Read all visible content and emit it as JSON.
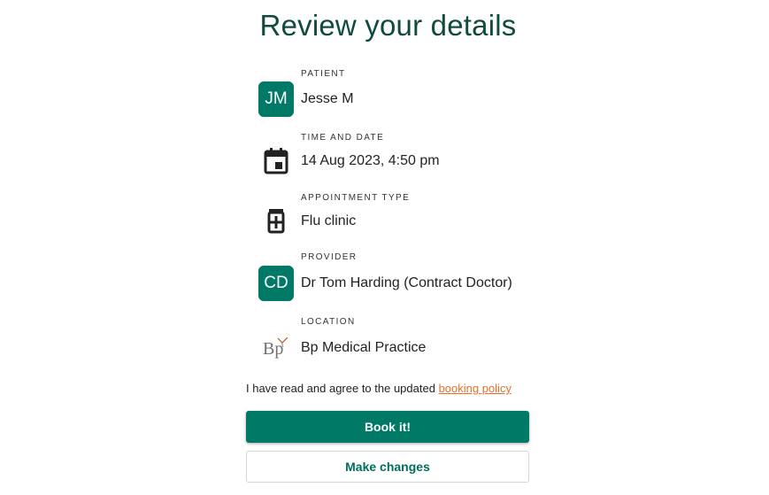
{
  "page": {
    "title": "Review your details"
  },
  "details": {
    "patient": {
      "label": "PATIENT",
      "initials": "JM",
      "value": "Jesse M"
    },
    "time_and_date": {
      "label": "TIME AND DATE",
      "icon": "calendar-icon",
      "value": "14 Aug 2023, 4:50 pm"
    },
    "appointment_type": {
      "label": "APPOINTMENT TYPE",
      "icon": "medicine-jar-icon",
      "value": "Flu clinic"
    },
    "provider": {
      "label": "PROVIDER",
      "initials": "CD",
      "value": "Dr Tom Harding (Contract Doctor)"
    },
    "location": {
      "label": "LOCATION",
      "logo_text": "Bp",
      "value": "Bp Medical Practice"
    }
  },
  "consent": {
    "text": "I have read and agree to the updated ",
    "link_text": "booking policy"
  },
  "actions": {
    "book_label": "Book it!",
    "change_label": "Make changes"
  },
  "colors": {
    "brand_green": "#007a66",
    "title_green": "#114a3f",
    "link_orange": "#e5702a"
  }
}
